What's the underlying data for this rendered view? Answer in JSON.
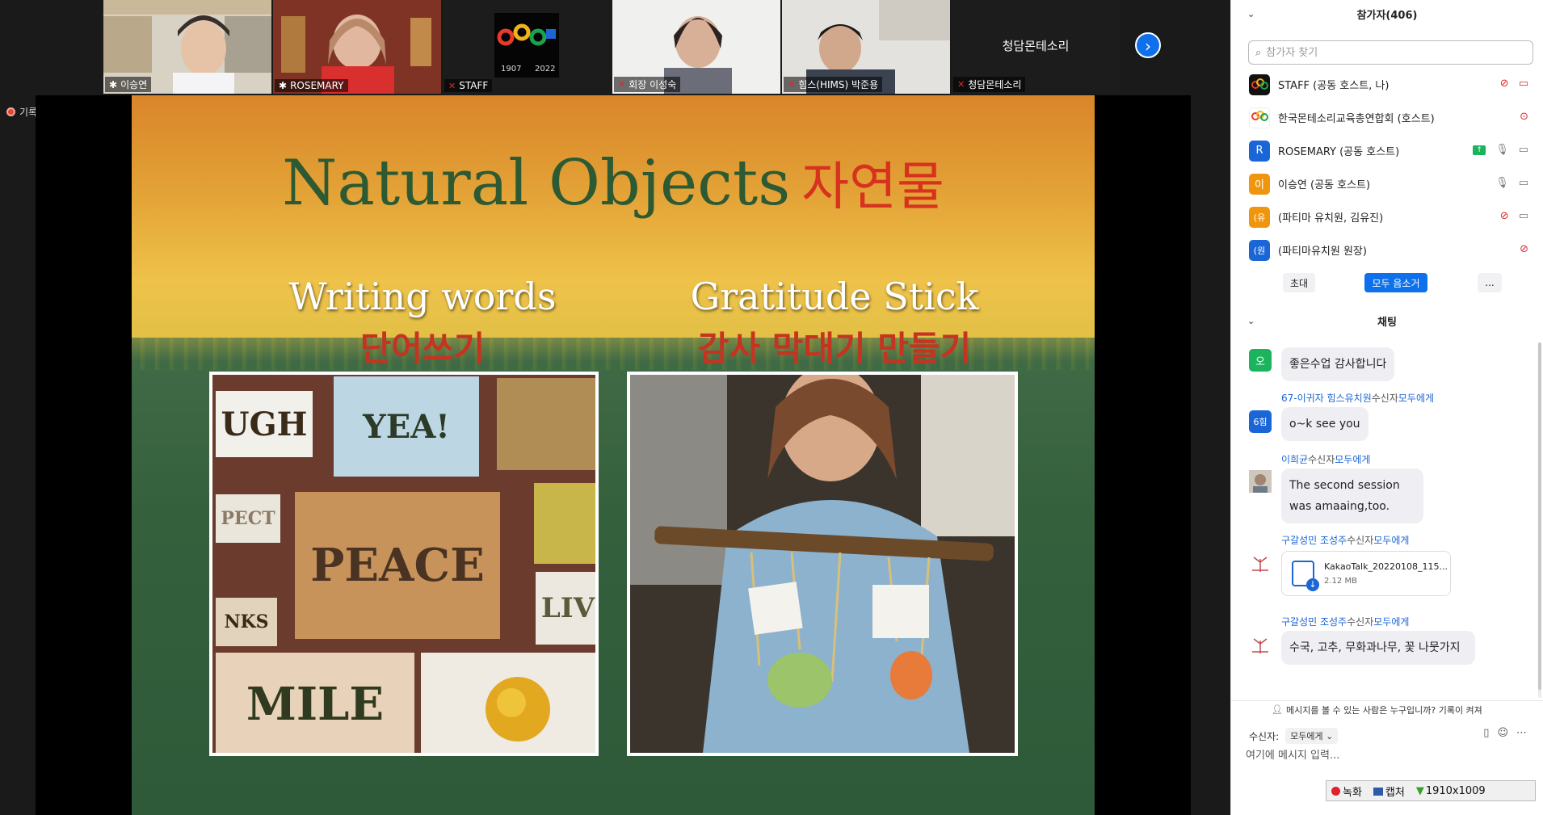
{
  "thumbnails": [
    {
      "id": "t1",
      "name": "이승연",
      "host_icon": true,
      "mic_off": false
    },
    {
      "id": "t2",
      "name": "ROSEMARY",
      "host_icon": true,
      "mic_off": false
    },
    {
      "id": "t3",
      "name": "STAFF",
      "host_icon": false,
      "mic_off": true,
      "logo_year_left": "1907",
      "logo_year_right": "2022"
    },
    {
      "id": "t4",
      "name": "회장 이성숙",
      "host_icon": false,
      "mic_off": true
    },
    {
      "id": "t5",
      "name": "힘스(HIMS) 박준용",
      "host_icon": false,
      "mic_off": true
    },
    {
      "id": "t6",
      "name": "청담몬테소리",
      "center_label": "청담몬테소리",
      "host_icon": false,
      "mic_off": true
    }
  ],
  "recording_label": "기록 중",
  "slide": {
    "title_en": "Natural Objects",
    "title_kr": "자연물",
    "left_heading_en": "Writing words",
    "left_heading_kr": "단어쓰기",
    "right_heading_en": "Gratitude Stick",
    "right_heading_kr": "감사 막대기 만들기",
    "collage_words": [
      "UGH",
      "YEA!",
      "PEACE",
      "PECT",
      "NKS",
      "LIV",
      "MILE"
    ]
  },
  "participants": {
    "title": "참가자(406)",
    "search_placeholder": "참가자 찾기",
    "list": [
      {
        "avatar": "S",
        "avatar_color": "#111111",
        "name": "STAFF (공동 호스트, 나)",
        "icons": [
          "mic-off",
          "video-off"
        ]
      },
      {
        "avatar": "K",
        "avatar_color": "#ffffff",
        "name": "한국몬테소리교육총연합회 (호스트)",
        "icons": [
          "recording"
        ]
      },
      {
        "avatar": "R",
        "avatar_color": "#1a66d6",
        "name": "ROSEMARY (공동 호스트)",
        "icons": [
          "share",
          "mic-on",
          "video-on"
        ]
      },
      {
        "avatar": "이",
        "avatar_color": "#f0960e",
        "name": "이승연 (공동 호스트)",
        "icons": [
          "mic-on",
          "video-on"
        ]
      },
      {
        "avatar": "(유",
        "avatar_color": "#f0960e",
        "name": "(파티마 유치원, 김유진)",
        "icons": [
          "mic-off",
          "video-on"
        ]
      },
      {
        "avatar": "(원",
        "avatar_color": "#1a66d6",
        "name": "(파티마유치원 원장)",
        "icons": [
          "mic-off"
        ]
      }
    ],
    "invite_label": "초대",
    "mute_all_label": "모두 음소거",
    "more_label": "..."
  },
  "chat": {
    "title": "채팅",
    "messages": [
      {
        "avatar": "오",
        "avatar_color": "#1bb35c",
        "sender": "",
        "to_label": "",
        "to": "",
        "text": "좋은수업 감사합니다"
      },
      {
        "avatar": "6힘",
        "avatar_color": "#1a66d6",
        "sender": "67-이귀자 힘스유치원",
        "to_label": "수신자",
        "to": "모두에게",
        "text": "o~k see you"
      },
      {
        "avatar": "",
        "avatar_color": "#888888",
        "sender": "이희균",
        "to_label": "수신자",
        "to": "모두에게",
        "text": "The second session was amaaing,too."
      },
      {
        "avatar": "",
        "avatar_color": "#ffffff",
        "sender": "구갈성민 조성주",
        "to_label": "수신자",
        "to": "모두에게",
        "file_name": "KakaoTalk_20220108_115...",
        "file_size": "2.12 MB"
      },
      {
        "avatar": "",
        "avatar_color": "#ffffff",
        "sender": "구갈성민 조성주",
        "to_label": "수신자",
        "to": "모두에게",
        "text": "수국, 고추, 무화과나무, 꽃 나뭇가지"
      }
    ],
    "visibility_note": "메시지를 볼 수 있는 사람은 누구입니까? 기록이 켜져",
    "recipient_label": "수신자:",
    "recipient_value": "모두에게 ⌄",
    "input_placeholder": "여기에 메시지 입력..."
  },
  "status_bar": {
    "record_label": "녹화",
    "capture_label": "캡처",
    "resolution": "1910x1009"
  }
}
